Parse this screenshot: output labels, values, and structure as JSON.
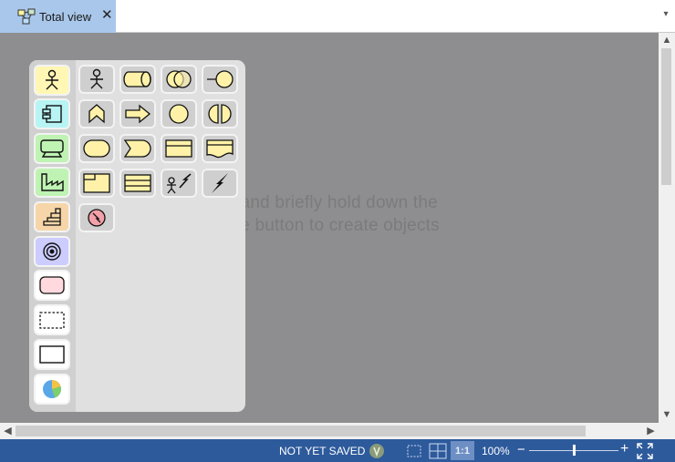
{
  "tab": {
    "label": "Total view",
    "close": "✕",
    "icon": "diagram-view-icon"
  },
  "tab_overflow": "▾",
  "hint": {
    "line1": "Click and briefly hold down the",
    "line2": "mouse button to create objects"
  },
  "palette": {
    "categories": [
      {
        "name": "actor-category-icon",
        "color": "#fff7b3",
        "selected": true
      },
      {
        "name": "application-component-category-icon",
        "color": "#b8f4f4"
      },
      {
        "name": "technology-node-category-icon",
        "color": "#bff3b3"
      },
      {
        "name": "physical-facility-category-icon",
        "color": "#bff3b3"
      },
      {
        "name": "implementation-category-icon",
        "color": "#f6d6a8"
      },
      {
        "name": "motivation-target-category-icon",
        "color": "#ccccff"
      },
      {
        "name": "grouping-rounded-category-icon",
        "color": "#ffd9de"
      },
      {
        "name": "group-dashed-category-icon",
        "color": "#ffffff"
      },
      {
        "name": "frame-category-icon",
        "color": "#ffffff"
      },
      {
        "name": "chart-category-icon",
        "color": "#ffffff"
      }
    ],
    "tools": [
      "business-actor-icon",
      "business-role-icon",
      "business-collaboration-icon",
      "business-interface-icon",
      "business-process-icon",
      "business-function-icon",
      "business-event-icon",
      "business-interaction-icon",
      "business-service-icon",
      "business-event-alt-icon",
      "business-object-icon",
      "representation-icon",
      "contract-icon",
      "product-icon",
      "actor-trigger-icon",
      "trigger-icon",
      "junction-trigger-icon"
    ],
    "tool_fill": "#fff2a8"
  },
  "scrollbars": {
    "up": "▲",
    "down": "▼",
    "left": "◀",
    "right": "▶"
  },
  "status": {
    "save_state": "NOT YET SAVED",
    "ratio_label": "1:1",
    "zoom": "100%",
    "zoom_minus": "−",
    "zoom_plus": "+",
    "zoom_level": 0.5
  },
  "colors": {
    "canvas": "#8e8e90",
    "statusbar": "#2d5a9b",
    "tab_active": "#a9c7ea"
  }
}
